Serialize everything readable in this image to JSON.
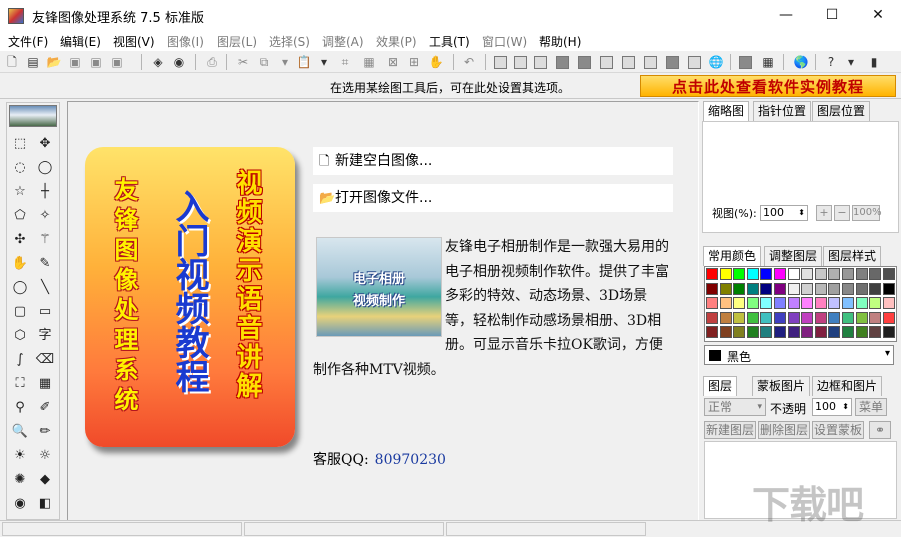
{
  "window": {
    "title": "友锋图像处理系统 7.5 标准版",
    "controls": {
      "minimize": "—",
      "maximize": "☐",
      "close": "✕"
    }
  },
  "menu": [
    {
      "label": "文件(F)",
      "enabled": true
    },
    {
      "label": "编辑(E)",
      "enabled": true
    },
    {
      "label": "视图(V)",
      "enabled": true
    },
    {
      "label": "图像(I)",
      "enabled": false
    },
    {
      "label": "图层(L)",
      "enabled": false
    },
    {
      "label": "选择(S)",
      "enabled": false
    },
    {
      "label": "调整(A)",
      "enabled": false
    },
    {
      "label": "效果(P)",
      "enabled": false
    },
    {
      "label": "工具(T)",
      "enabled": true
    },
    {
      "label": "窗口(W)",
      "enabled": false
    },
    {
      "label": "帮助(H)",
      "enabled": true
    }
  ],
  "options_bar": {
    "hint": "在选用某绘图工具后，可在此处设置其选项。",
    "tutorial_banner": "点击此处查看软件实例教程"
  },
  "welcome": {
    "poster": {
      "left_column": "友锋图像处理系统",
      "middle_column": "入门视频教程",
      "right_column": "视频演示语音讲解"
    },
    "new_image": "新建空白图像...",
    "open_image": "打开图像文件...",
    "thumb_line1": "电子相册",
    "thumb_line2": "视频制作",
    "description": "友锋电子相册制作是一款强大易用的电子相册视频制作软件。提供了丰富多彩的特效、动态场景、3D场景等，轻松制作动感场景相册、3D相册。可显示音乐卡拉OK歌词，方便制作各种MTV视频。",
    "qq_label": "客服QQ:",
    "qq_number": "80970230"
  },
  "right_panel": {
    "nav_tabs": [
      "缩略图",
      "指针位置",
      "图层位置"
    ],
    "zoom_label": "视图(%):",
    "zoom_value": "100",
    "zoom_100": "100%",
    "color_tabs": [
      "常用颜色",
      "调整图层",
      "图层样式"
    ],
    "color_selected": "黑色",
    "layer_tabs": [
      "图层",
      "蒙板图片",
      "边框和图片"
    ],
    "blend_mode": "正常",
    "opacity_label": "不透明",
    "opacity_value": "100",
    "menu_btn": "菜单",
    "new_layer": "新建图层",
    "delete_layer": "删除图层",
    "set_mask": "设置蒙板"
  },
  "palette_colors": [
    "#ff0000",
    "#ffff00",
    "#00ff00",
    "#00ffff",
    "#0000ff",
    "#ff00ff",
    "#ffffff",
    "#e0e0e0",
    "#c8c8c8",
    "#b0b0b0",
    "#989898",
    "#808080",
    "#686868",
    "#505050",
    "#800000",
    "#808000",
    "#008000",
    "#008080",
    "#000080",
    "#800080",
    "#f0f0f0",
    "#d0d0d0",
    "#b8b8b8",
    "#a0a0a0",
    "#888888",
    "#707070",
    "#404040",
    "#000000",
    "#ff8080",
    "#ffc080",
    "#ffff80",
    "#80ff80",
    "#80ffff",
    "#8080ff",
    "#c080ff",
    "#ff80ff",
    "#ff80c0",
    "#c0c0ff",
    "#80c0ff",
    "#80ffc0",
    "#c0ff80",
    "#ffc0c0",
    "#c04040",
    "#c08040",
    "#c0c040",
    "#40c040",
    "#40c0c0",
    "#4040c0",
    "#8040c0",
    "#c040c0",
    "#c04080",
    "#4080c0",
    "#40c080",
    "#80c040",
    "#c08080",
    "#ff4040",
    "#802020",
    "#804020",
    "#808020",
    "#208020",
    "#208080",
    "#202080",
    "#402080",
    "#802080",
    "#802040",
    "#204080",
    "#208040",
    "#408020",
    "#604040",
    "#202020"
  ],
  "watermark": "下载吧"
}
